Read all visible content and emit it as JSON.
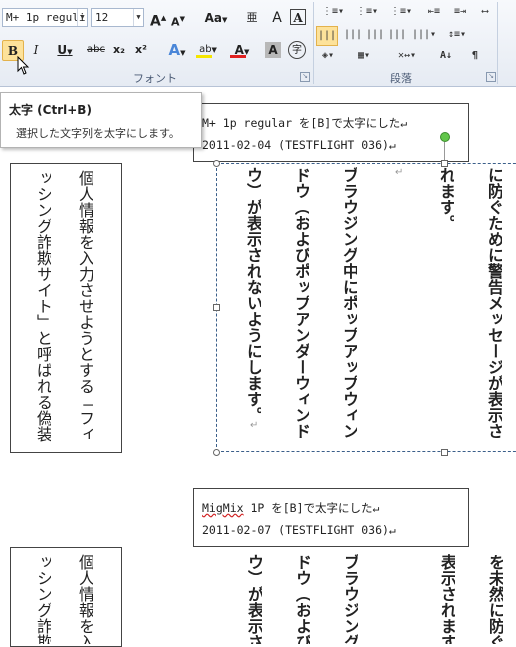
{
  "ribbon": {
    "font_name": "M+ 1p reguli",
    "font_size": "12",
    "grow_font": "A",
    "shrink_font": "A",
    "change_case": "Aa",
    "phonetic": "亜",
    "clear_format": "A",
    "bold": "B",
    "italic": "I",
    "underline": "U",
    "strikethrough": "abc",
    "subscript": "x₂",
    "superscript": "x²",
    "text_effect": "A",
    "highlight": "ab",
    "font_color": "A",
    "char_shading": "A",
    "enclose": "字",
    "font_group_label": "フォント",
    "paragraph_group_label": "段落",
    "highlight_color": "#f5e600",
    "font_color_value": "#e02020",
    "accent_color": "#fde29a"
  },
  "tooltip": {
    "title": "太字 (Ctrl+B)",
    "description": "選択した文字列を太字にします。"
  },
  "doc": {
    "box1_line1": "M+ 1p regular を[B]で太字にした↵",
    "box1_line2": "2011-02-04 (TESTFLIGHT 036)↵",
    "left_col1": "個人情報を入力させようとする「フィ",
    "left_col2": "ッシング詐欺サイト」と呼ばれる偽装",
    "bold_col1": "に防ぐために警告メッセージが表示さ",
    "bold_col2": "れます。",
    "bold_col3": "ブラウジング中にポップアップウィン",
    "bold_col4": "ドウ（およびポップアンダーウィンド",
    "bold_col5": "ウ）が表示されないようにします。",
    "box2_line1": "MigMix 1P を[B]で太字にした↵",
    "box2_line2": "2011-02-07 (TESTFLIGHT 036)↵",
    "lower_left_col1": "個人情報を入",
    "lower_left_col2": "ッシング詐欺",
    "lower_bold_col1": "を未然に防ぐ",
    "lower_bold_col2": "表示されます",
    "lower_bold_col3": "ブラウジング",
    "lower_bold_col4": "ドウ（および",
    "lower_bold_col5": "ウ）が表示さ"
  }
}
